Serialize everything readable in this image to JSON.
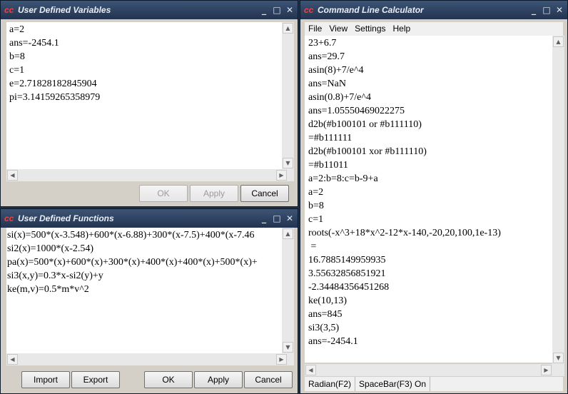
{
  "vars_window": {
    "title": "User Defined Variables",
    "lines": [
      "a=2",
      "ans=-2454.1",
      "b=8",
      "c=1",
      "e=2.71828182845904",
      "pi=3.14159265358979"
    ],
    "ok_label": "OK",
    "apply_label": "Apply",
    "cancel_label": "Cancel"
  },
  "funcs_window": {
    "title": "User Defined Functions",
    "lines": [
      "si(x)=500*(x-3.548)+600*(x-6.88)+300*(x-7.5)+400*(x-7.46",
      "si2(x)=1000*(x-2.54)",
      "pa(x)=500*(x)+600*(x)+300*(x)+400*(x)+400*(x)+500*(x)+",
      "si3(x,y)=0.3*x-si2(y)+y",
      "ke(m,v)=0.5*m*v^2"
    ],
    "import_label": "Import",
    "export_label": "Export",
    "ok_label": "OK",
    "apply_label": "Apply",
    "cancel_label": "Cancel"
  },
  "calc_window": {
    "title": "Command Line Calculator",
    "menu": [
      "File",
      "View",
      "Settings",
      "Help"
    ],
    "lines": [
      "23+6.7",
      "ans=29.7",
      "asin(8)+7/e^4",
      "ans=NaN",
      "asin(0.8)+7/e^4",
      "ans=1.05550469022275",
      "d2b(#b100101 or #b111110)",
      "=#b111111",
      "d2b(#b100101 xor #b111110)",
      "=#b11011",
      "a=2:b=8:c=b-9+a",
      "a=2",
      "b=8",
      "c=1",
      "roots(-x^3+18*x^2-12*x-140,-20,20,100,1e-13)",
      " =",
      "16.7885149959935",
      "3.55632856851921",
      "-2.34484356451268",
      "ke(10,13)",
      "ans=845",
      "si3(3,5)",
      "ans=-2454.1"
    ],
    "status_mode": "Radian(F2)",
    "status_spacebar": "SpaceBar(F3) On"
  },
  "titlebar_buttons": {
    "minimize": "_",
    "maximize": "□",
    "close": "✕"
  },
  "logo_text": "cc"
}
